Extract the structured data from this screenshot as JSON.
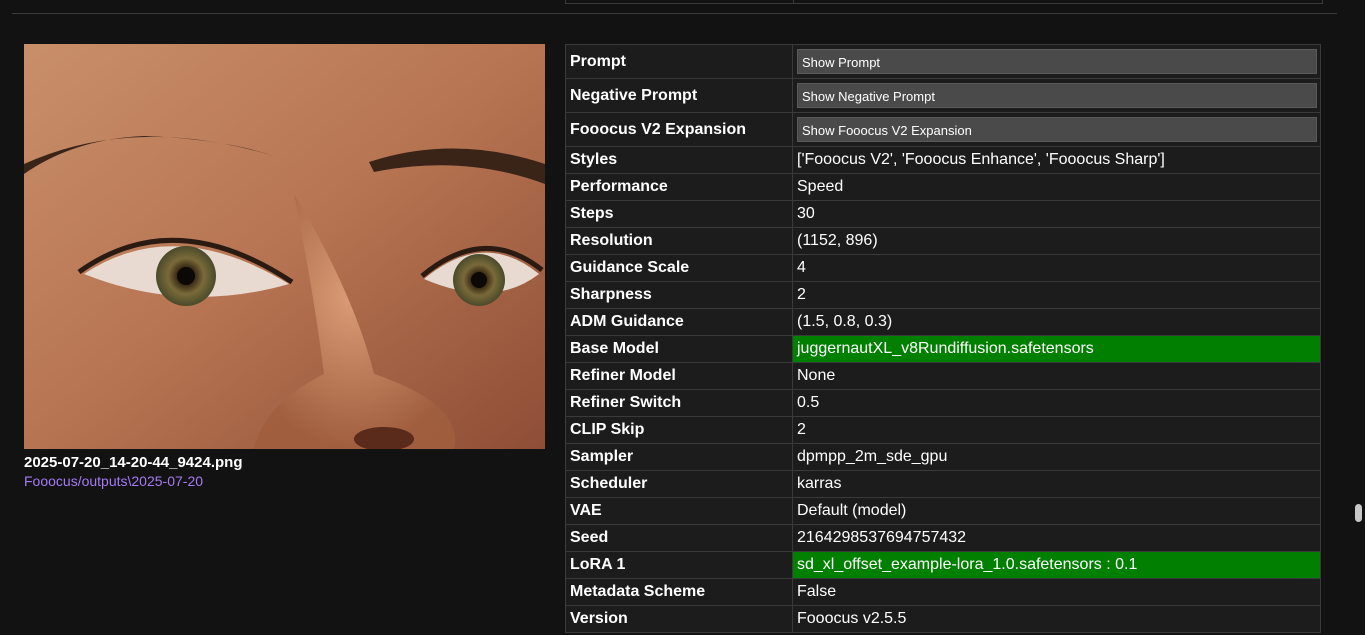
{
  "image": {
    "filename": "2025-07-20_14-20-44_9424.png",
    "path": "Fooocus/outputs\\2025-07-20"
  },
  "metadata": [
    {
      "key": "Prompt",
      "button": "Show Prompt"
    },
    {
      "key": "Negative Prompt",
      "button": "Show Negative Prompt"
    },
    {
      "key": "Fooocus V2 Expansion",
      "button": "Show Fooocus V2 Expansion"
    },
    {
      "key": "Styles",
      "value": "['Fooocus V2', 'Fooocus Enhance', 'Fooocus Sharp']"
    },
    {
      "key": "Performance",
      "value": "Speed"
    },
    {
      "key": "Steps",
      "value": "30"
    },
    {
      "key": "Resolution",
      "value": "(1152, 896)"
    },
    {
      "key": "Guidance Scale",
      "value": "4"
    },
    {
      "key": "Sharpness",
      "value": "2"
    },
    {
      "key": "ADM Guidance",
      "value": "(1.5, 0.8, 0.3)"
    },
    {
      "key": "Base Model",
      "value": "juggernautXL_v8Rundiffusion.safetensors",
      "highlight": true
    },
    {
      "key": "Refiner Model",
      "value": "None"
    },
    {
      "key": "Refiner Switch",
      "value": "0.5"
    },
    {
      "key": "CLIP Skip",
      "value": "2"
    },
    {
      "key": "Sampler",
      "value": "dpmpp_2m_sde_gpu"
    },
    {
      "key": "Scheduler",
      "value": "karras"
    },
    {
      "key": "VAE",
      "value": "Default (model)"
    },
    {
      "key": "Seed",
      "value": "2164298537694757432"
    },
    {
      "key": "LoRA 1",
      "value": "sd_xl_offset_example-lora_1.0.safetensors : 0.1",
      "highlight": true
    },
    {
      "key": "Metadata Scheme",
      "value": "False"
    },
    {
      "key": "Version",
      "value": "Fooocus v2.5.5"
    }
  ],
  "colors": {
    "background": "#121212",
    "highlight": "#007f00",
    "link": "#a77af4"
  }
}
